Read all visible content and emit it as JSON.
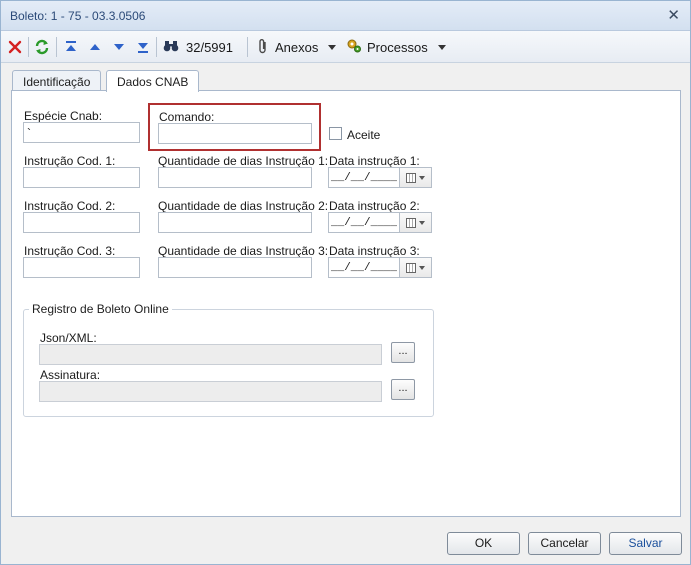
{
  "window": {
    "title": "Boleto: 1 - 75 - 03.3.0506",
    "close_glyph": "✕"
  },
  "toolbar": {
    "record_counter": "32/5991",
    "anexos_label": "Anexos",
    "processos_label": "Processos",
    "icons": [
      "delete-icon",
      "refresh-icon",
      "first-record-icon",
      "previous-record-icon",
      "next-record-icon",
      "last-record-icon",
      "binoculars-icon",
      "paperclip-icon",
      "processes-icon"
    ]
  },
  "tabs": [
    {
      "label": "Identificação",
      "active": false
    },
    {
      "label": "Dados CNAB",
      "active": true
    }
  ],
  "form": {
    "especie_cnab": {
      "label": "Espécie Cnab:",
      "value": "`"
    },
    "comando": {
      "label": "Comando:",
      "value": ""
    },
    "aceite": {
      "label": "Aceite",
      "checked": false
    },
    "instrucao1": {
      "label": "Instrução Cod. 1:",
      "value": ""
    },
    "qtd_dias1": {
      "label": "Quantidade de dias Instrução 1:",
      "value": ""
    },
    "data1": {
      "label": "Data instrução 1:",
      "value": "__/__/____"
    },
    "instrucao2": {
      "label": "Instrução Cod. 2:",
      "value": ""
    },
    "qtd_dias2": {
      "label": "Quantidade de dias Instrução 2:",
      "value": ""
    },
    "data2": {
      "label": "Data instrução 2:",
      "value": "__/__/____"
    },
    "instrucao3": {
      "label": "Instrução Cod. 3:",
      "value": ""
    },
    "qtd_dias3": {
      "label": "Quantidade de dias Instrução 3:",
      "value": ""
    },
    "data3": {
      "label": "Data instrução 3:",
      "value": "__/__/____"
    }
  },
  "registro": {
    "title": "Registro de Boleto Online",
    "json_label": "Json/XML:",
    "json_value": "",
    "assinatura_label": "Assinatura:",
    "assinatura_value": "",
    "ellipsis": "..."
  },
  "footer": {
    "ok_label": "OK",
    "cancel_label": "Cancelar",
    "save_label": "Salvar"
  },
  "colors": {
    "highlight": "#b03030",
    "delete_red": "#d42020",
    "refresh_green": "#2a9a2a",
    "nav_blue": "#2e62c9"
  }
}
